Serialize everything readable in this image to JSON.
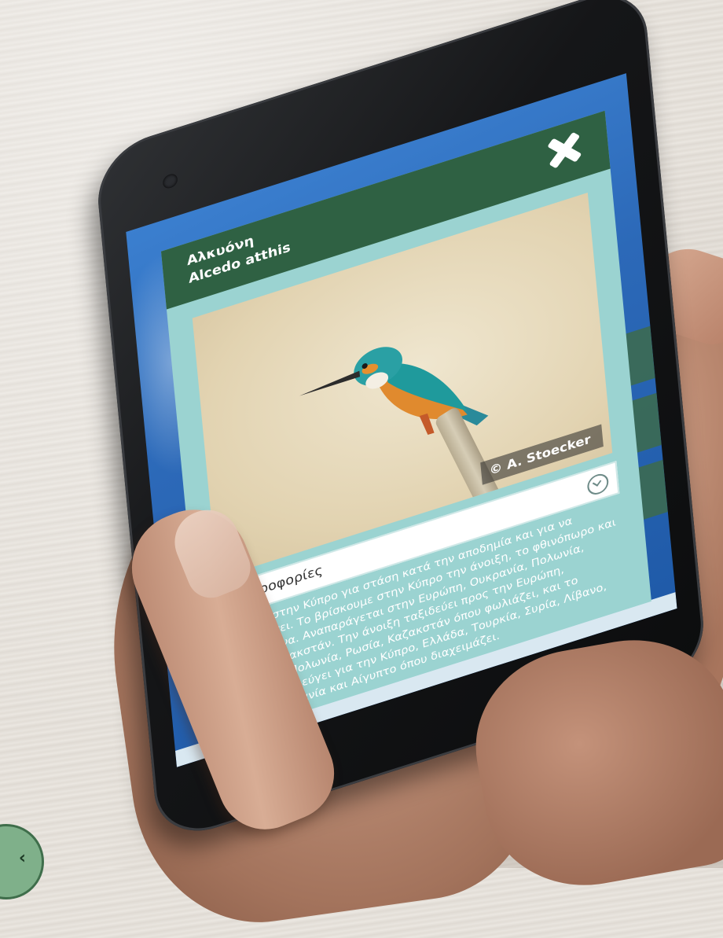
{
  "modal": {
    "common_name": "Αλκυόνη",
    "latin_name": "Alcedo atthis",
    "close_icon": "close-icon",
    "photo_credit": "© A. Stoecker",
    "info_label": "Πληροφορίες",
    "download_icon": "download-icon",
    "description": "Έρχεται στην Κύπρο για στάση κατά την αποδημία και για να διαχειμάσει. Το βρίσκουμε στην Κύπρο την άνοιξη, το φθινόπωρο και τον χειμώνα. Αναπαράγεται στην Ευρώπη, Ουκρανία, Πολωνία, Ρωσία, Καζακστάν. Την άνοιξη ταξιδεύει προς την Ευρώπη, Ουκρανία, Πολωνία, Ρωσία, Καζακστάν όπου φωλιάζει, και το φθινόπωρο φεύγει για την Κύπρο, Ελλάδα, Τουρκία, Συρία, Λίβανο, Ισραήλ, Ιορδανία και Αίγυπτο όπου διαχειμάζει."
  },
  "colors": {
    "header": "#2f6143",
    "modal_bg": "#9bd3d1",
    "screen_bg": "#2c69b8"
  }
}
